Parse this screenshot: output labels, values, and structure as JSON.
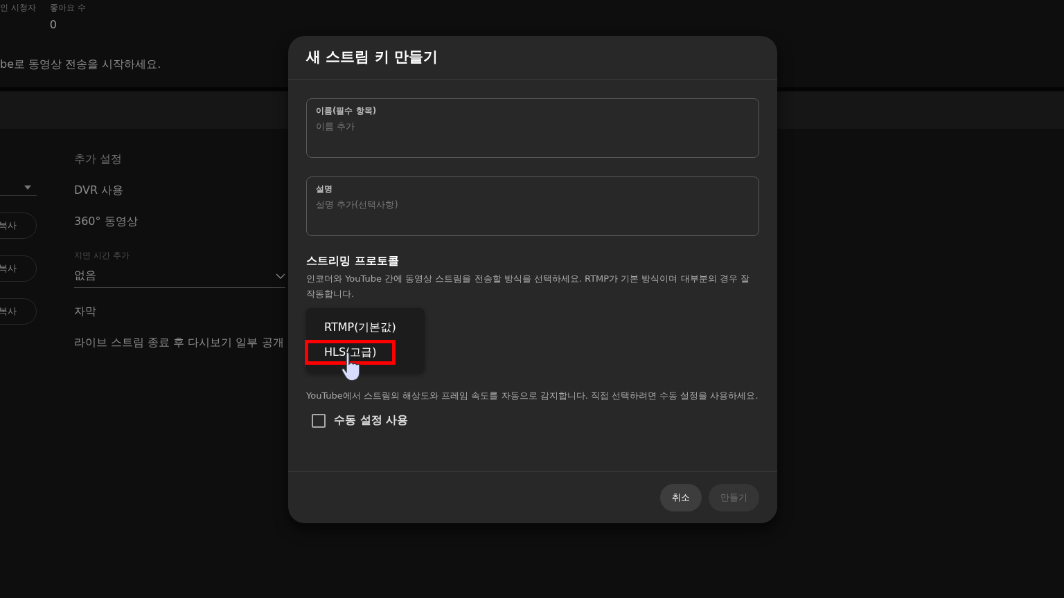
{
  "background": {
    "stats": [
      {
        "label": "인 시청자"
      },
      {
        "label": "좋아요 수",
        "value": "0"
      }
    ],
    "notice": "be로 동영상 전송을 시작하세요.",
    "copy_buttons": [
      "복사",
      "복사",
      "복사"
    ],
    "settings_heading": "추가 설정",
    "settings": [
      {
        "kind": "toggle",
        "label": "DVR 사용"
      },
      {
        "kind": "toggle",
        "label": "360° 동영상"
      },
      {
        "kind": "select",
        "label": "지연 시간 추가",
        "value": "없음"
      },
      {
        "kind": "toggle",
        "label": "자막"
      },
      {
        "kind": "toggle",
        "label": "라이브 스트림 종료 후 다시보기 일부 공개"
      }
    ]
  },
  "dialog": {
    "title": "새 스트림 키 만들기",
    "fields": [
      {
        "label": "이름(필수 항목)",
        "placeholder": "이름 추가"
      },
      {
        "label": "설명",
        "placeholder": "설명 추가(선택사항)"
      }
    ],
    "protocol": {
      "title": "스트리밍 프로토콜",
      "description": "인코더와 YouTube 간에 동영상 스트림을 전송할 방식을 선택하세요. RTMP가 기본 방식이며 대부분의 경우 잘 작동합니다.",
      "options": [
        {
          "label": "RTMP(기본값)",
          "highlighted": false
        },
        {
          "label": "HLS(고급)",
          "highlighted": true
        }
      ]
    },
    "resolution": {
      "description": "YouTube에서 스트림의 해상도와 프레임 속도를 자동으로 감지합니다. 직접 선택하려면 수동 설정을 사용하세요.",
      "checkbox": {
        "label": "수동 설정 사용",
        "checked": false
      }
    },
    "buttons": [
      {
        "label": "취소",
        "disabled": false
      },
      {
        "label": "만들기",
        "disabled": true
      }
    ]
  }
}
